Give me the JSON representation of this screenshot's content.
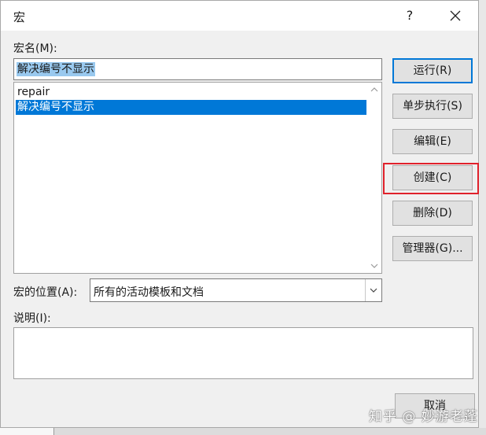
{
  "window": {
    "title": "宏",
    "help_label": "?"
  },
  "macro_name": {
    "label": "宏名(M):",
    "value": "解决编号不显示"
  },
  "macro_list": {
    "items": [
      "repair",
      "解决编号不显示"
    ],
    "selected_index": 1
  },
  "location": {
    "label": "宏的位置(A):",
    "value": "所有的活动模板和文档"
  },
  "description": {
    "label": "说明(I):",
    "value": ""
  },
  "buttons": {
    "run": "运行(R)",
    "step": "单步执行(S)",
    "edit": "编辑(E)",
    "create": "创建(C)",
    "delete": "删除(D)",
    "organizer": "管理器(G)...",
    "cancel": "取消"
  },
  "watermark": "知乎 @ 妙游老蓬",
  "colors": {
    "selection": "#0078d7",
    "highlight_box": "#e0212b",
    "input_selection": "#99c9ef"
  }
}
